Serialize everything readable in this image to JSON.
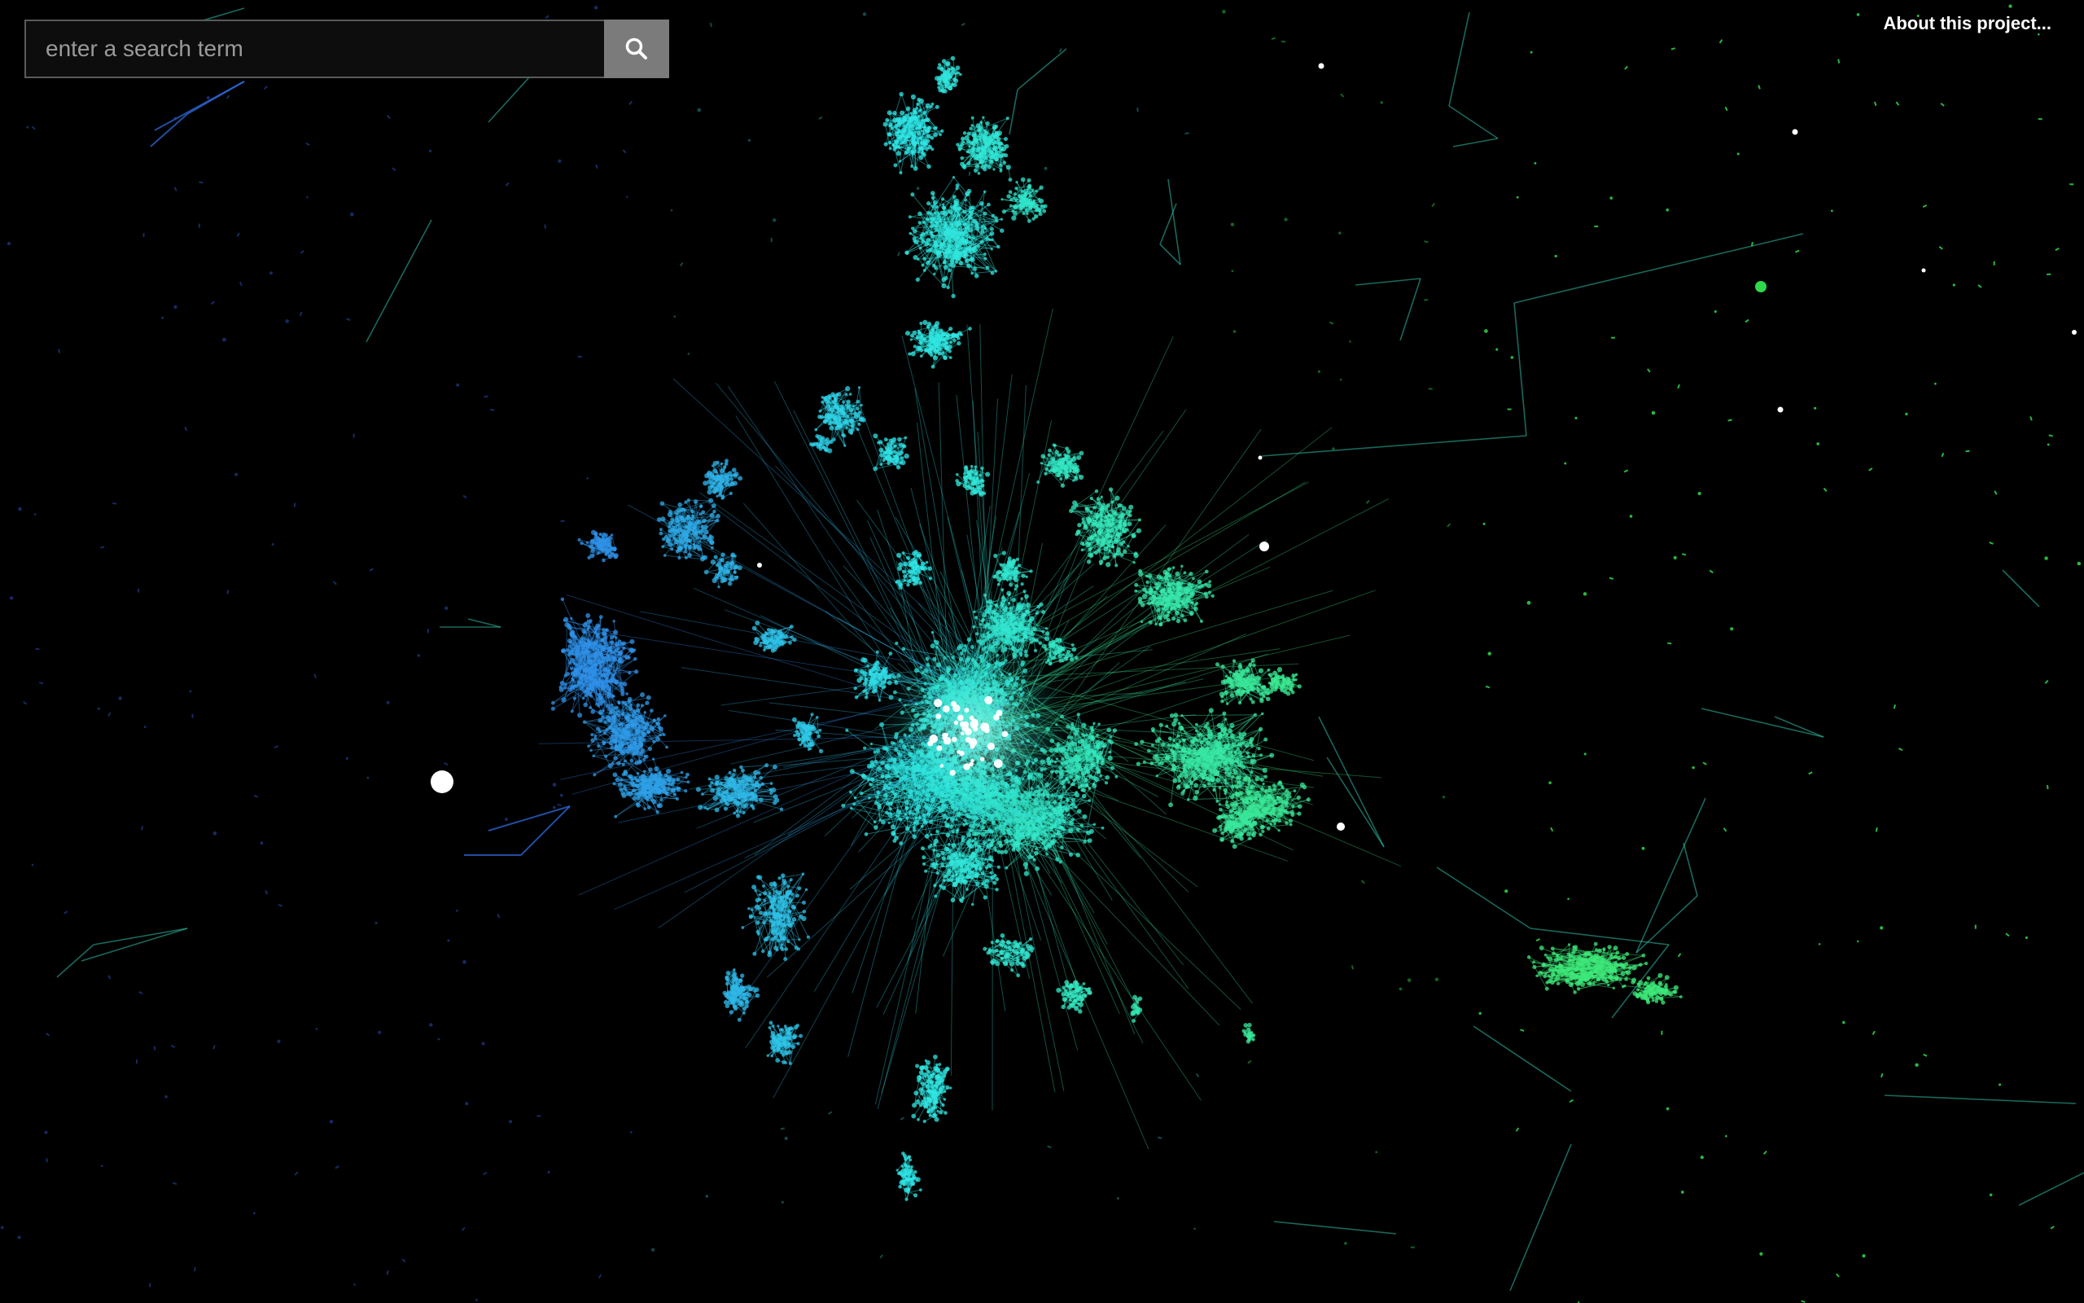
{
  "search": {
    "placeholder": "enter a search term",
    "value": ""
  },
  "header": {
    "about_label": "About this project..."
  },
  "icons": {
    "search_button": "search-icon"
  },
  "colors": {
    "background": "#000000",
    "blue": "#2f7fe8",
    "cyan": "#2fe6e6",
    "green": "#3de87a",
    "node_highlight": "#ffffff",
    "search_button_bg": "#7b7b7b"
  }
}
